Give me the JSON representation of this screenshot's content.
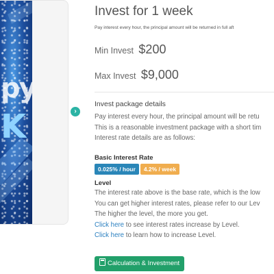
{
  "banner": {
    "text_line1": "py",
    "text_line2": "K"
  },
  "package": {
    "title": "Invest for 1 week",
    "subtitle": "Pay interest every hour, the principal amount will be returned in full aft",
    "min_label": "Min Invest",
    "min_value": "$200",
    "max_label": "Max Invest",
    "max_value": "$9,000"
  },
  "details": {
    "heading": "Invest package details",
    "lines": [
      "Pay interest every hour, the principal amount will be retu",
      "This is a reasonable investment package with a short tim",
      "Interest rate details are as follows:"
    ],
    "rate_heading": "Basic Interest Rate",
    "rate_hour": "0.025% / hour",
    "rate_week": "4.2% / week",
    "level_heading": "Level",
    "level_lines": [
      "The interest rate above is the base rate, which is the low",
      "You can get higher interest rates, please refer to our Lev",
      "The higher the level, the more you get."
    ],
    "link1_text": "Click here",
    "link1_rest": " to see interest rates increase by Level.",
    "link2_text": "Click here",
    "link2_rest": " to learn how to increase Level."
  },
  "actions": {
    "calc_label": "Calculation & Investment"
  },
  "colors": {
    "accent_green": "#22a06a",
    "badge_blue": "#2a86b8",
    "badge_orange": "#f0ad4e",
    "link": "#2a7fc0"
  },
  "icons": {
    "arrow": "chevron-right-icon",
    "calculator": "calculator-icon"
  }
}
